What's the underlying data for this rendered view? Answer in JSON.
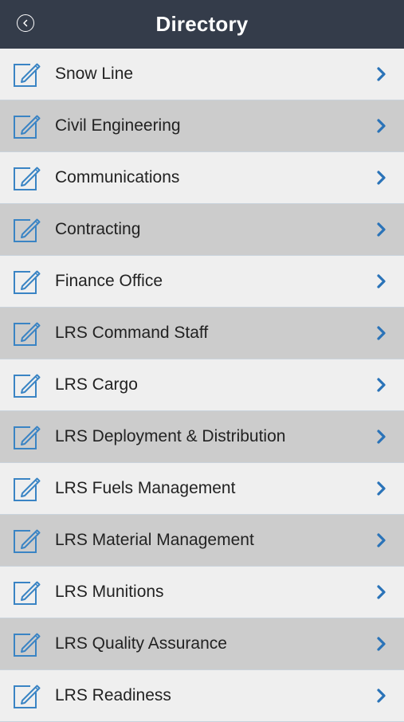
{
  "header": {
    "title": "Directory",
    "back_icon": "chevron-left-circle-icon"
  },
  "colors": {
    "header_bg": "#343c4a",
    "row_light": "#efefef",
    "row_dark": "#cccccc",
    "accent": "#2a73b8",
    "icon_stroke": "#3a84c4"
  },
  "list": {
    "row_icon": "edit-note-icon",
    "row_chevron": "chevron-right-icon",
    "items": [
      {
        "label": "Snow Line"
      },
      {
        "label": "Civil Engineering"
      },
      {
        "label": "Communications"
      },
      {
        "label": "Contracting"
      },
      {
        "label": "Finance Office"
      },
      {
        "label": "LRS Command Staff"
      },
      {
        "label": "LRS Cargo"
      },
      {
        "label": "LRS Deployment & Distribution"
      },
      {
        "label": "LRS Fuels Management"
      },
      {
        "label": "LRS Material Management"
      },
      {
        "label": "LRS Munitions"
      },
      {
        "label": "LRS Quality Assurance"
      },
      {
        "label": "LRS Readiness"
      }
    ]
  }
}
